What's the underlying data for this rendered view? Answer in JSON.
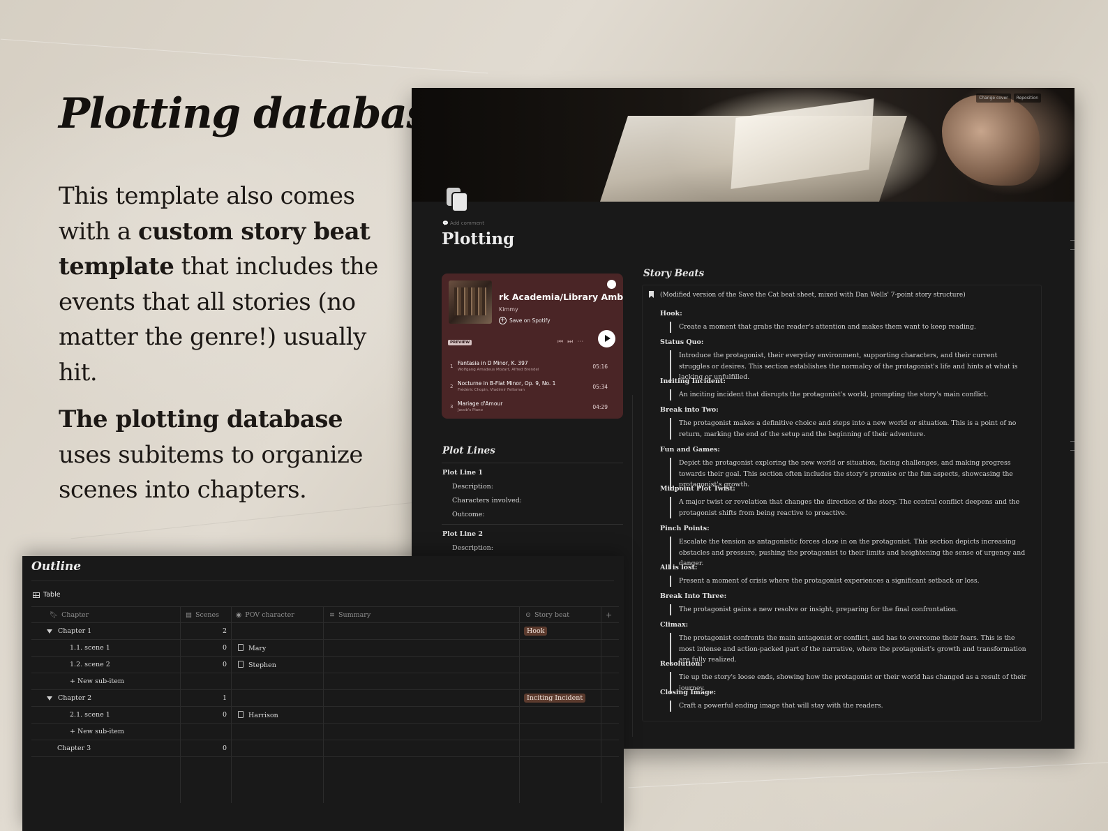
{
  "headline": "Plotting database",
  "intro": {
    "p1_pre": "This template also comes with a ",
    "p1_bold": "custom story beat template",
    "p1_post": " that includes the events that all stories (no matter the genre!) usually hit.",
    "p2_bold": "The plotting database",
    "p2_post": " uses subitems to organize scenes into chapters."
  },
  "page": {
    "cover_buttons": [
      "Change cover",
      "Reposition"
    ],
    "add_comment": "Add comment",
    "title": "Plotting"
  },
  "spotify": {
    "playlist_title": "rk Academia/Library Ambien",
    "artist": "Kimmy",
    "save_label": "Save on Spotify",
    "preview_badge": "PREVIEW",
    "tracks": [
      {
        "n": "1",
        "title": "Fantasia in D Minor, K. 397",
        "artist": "Wolfgang Amadeus Mozart, Alfred Brendel",
        "dur": "05:16"
      },
      {
        "n": "2",
        "title": "Nocturne in B-Flat Minor, Op. 9, No. 1",
        "artist": "Frédéric Chopin, Vladimir Feltsman",
        "dur": "05:34"
      },
      {
        "n": "3",
        "title": "Mariage d'Amour",
        "artist": "Jacob's Piano",
        "dur": "04:29"
      }
    ]
  },
  "plot_lines": {
    "heading": "Plot Lines",
    "line1": "Plot Line 1",
    "description": "Description:",
    "characters": "Characters involved:",
    "outcome": "Outcome:",
    "line2": "Plot Line 2",
    "description2": "Description:"
  },
  "story_beats": {
    "heading": "Story Beats",
    "note": "(Modified version of the Save the Cat beat sheet, mixed with Dan Wells' 7-point story structure)",
    "beats": [
      {
        "label": "Hook:",
        "text": "Create a moment that grabs the reader's attention and makes them want to keep reading."
      },
      {
        "label": "Status Quo:",
        "text": "Introduce the protagonist, their everyday environment, supporting characters, and their current struggles or desires. This section establishes the normalcy of the protagonist's life and hints at what is lacking or unfulfilled."
      },
      {
        "label": "Inciting Incident:",
        "text": "An inciting incident that disrupts the protagonist's world, prompting the story's main conflict."
      },
      {
        "label": "Break into Two:",
        "text": "The protagonist makes a definitive choice and steps into a new world or situation. This is a point of no return, marking the end of the setup and the beginning of their adventure."
      },
      {
        "label": "Fun and Games:",
        "text": "Depict the protagonist exploring the new world or situation, facing challenges, and making progress towards their goal. This section often includes the story's promise or the fun aspects, showcasing the protagonist's growth."
      },
      {
        "label": "Midpoint Plot Twist:",
        "text": "A major twist or revelation that changes the direction of the story. The central conflict deepens and the protagonist shifts from being reactive to proactive."
      },
      {
        "label": "Pinch Points:",
        "text": "Escalate the tension as antagonistic forces close in on the protagonist. This section depicts increasing obstacles and pressure, pushing the protagonist to their limits and heightening the sense of urgency and danger."
      },
      {
        "label": "All is lost:",
        "text": "Present a moment of crisis where the protagonist experiences a significant setback or loss."
      },
      {
        "label": "Break Into Three:",
        "text": "The protagonist gains a new resolve or insight, preparing for the final confrontation."
      },
      {
        "label": "Climax:",
        "text": "The protagonist confronts the main antagonist or conflict, and has to overcome their fears. This is the most intense and action-packed part of the narrative, where the protagonist's growth and transformation are fully realized."
      },
      {
        "label": "Resolution:",
        "text": "Tie up the story's loose ends, showing how the protagonist or their world has changed as a result of their journey."
      },
      {
        "label": "Closing Image:",
        "text": "Craft a powerful ending image that will stay with the readers."
      }
    ]
  },
  "outline": {
    "title": "Outline",
    "view_tab": "Table",
    "columns": [
      "Chapter",
      "Scenes",
      "POV character",
      "Summary",
      "Story beat"
    ],
    "new_sub_item": "New sub-item",
    "rows": [
      {
        "chapter": "Chapter 1",
        "scenes": "2",
        "pov": "",
        "beat": "Hook"
      },
      {
        "chapter": "1.1. scene 1",
        "scenes": "0",
        "pov": "Mary",
        "beat": ""
      },
      {
        "chapter": "1.2. scene 2",
        "scenes": "0",
        "pov": "Stephen",
        "beat": ""
      },
      {
        "chapter": "Chapter 2",
        "scenes": "1",
        "pov": "",
        "beat": "Inciting Incident"
      },
      {
        "chapter": "2.1. scene 1",
        "scenes": "0",
        "pov": "Harrison",
        "beat": ""
      },
      {
        "chapter": "Chapter 3",
        "scenes": "0",
        "pov": "",
        "beat": ""
      }
    ]
  }
}
